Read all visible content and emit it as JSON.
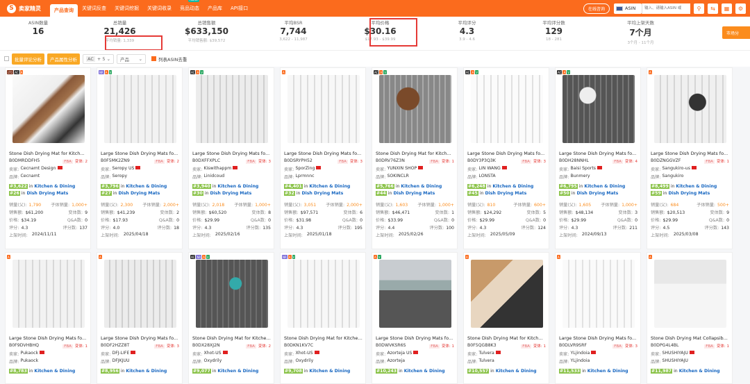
{
  "app": {
    "logo_text": "卖家精灵"
  },
  "nav": {
    "tabs": [
      "产品查询",
      "关键词反查",
      "关键词挖掘",
      "关键词收录",
      "竞品动态",
      "产品库",
      "API接口"
    ],
    "active": 0,
    "new_badge": "NEW",
    "online_consult": "在线咨询",
    "market": "ASIN",
    "search_placeholder": "输入、请输入ASIN 或"
  },
  "stats": [
    {
      "label": "ASIN数量",
      "value": "16",
      "sub": ""
    },
    {
      "label": "总销量",
      "value": "21,426",
      "sub": "平均销量: 1,339"
    },
    {
      "label": "总销售额",
      "value": "$633,150",
      "sub": "平均销售额: $39,572"
    },
    {
      "label": "平均BSR",
      "value": "7,744",
      "sub": "3,622 - 11,987"
    },
    {
      "label": "平均价格",
      "value": "$30.16",
      "sub": "$17.93 - $39.99"
    },
    {
      "label": "平均评分",
      "value": "4.3",
      "sub": "3.9 - 4.6"
    },
    {
      "label": "平均评分数",
      "value": "129",
      "sub": "18 - 281"
    },
    {
      "label": "平均上架天数",
      "value": "7个月",
      "sub": "3个月 - 11个月"
    }
  ],
  "trend_button": "市场分",
  "filters": {
    "batch_review": "批量评论分析",
    "attribute": "产品属性分析",
    "ac_label": "AC",
    "count_label": "+ 5",
    "product_select": "产品",
    "dedupe": "列表ASIN去重"
  },
  "field_labels": {
    "seller": "卖家:",
    "brand": "品牌:",
    "sales": "销量(父):",
    "child_sales": "子体销量:",
    "revenue": "销售额:",
    "variants": "变体数:",
    "price": "价格:",
    "qa": "Q&A数:",
    "rating": "评分:",
    "reviews": "评分数:",
    "listed": "上架时间:",
    "in": "in"
  },
  "products": [
    {
      "title": "Stone Dish Drying Mat for Kitch...",
      "asin": "B0DMRDDFH5",
      "fba": "FBA",
      "var": "变体: 2",
      "seller": "Cecnamt Design",
      "brand": "Cecnamt",
      "rank1": "#3,622",
      "cat1": "Kitchen & Dining",
      "rank2": "#26",
      "cat2": "Dish Drying Mats",
      "sales": "1,790",
      "child": "1,000+",
      "revenue": "$61,200",
      "variants": "9",
      "price": "$34.19",
      "qa": "0",
      "rating": "4.3",
      "reviews": "137",
      "listed": "2024/11/11",
      "badges": [
        "LTD",
        "AC",
        "A"
      ],
      "img": "a"
    },
    {
      "title": "Large Stone Dish Drying Mats fo...",
      "asin": "B0F5MK2ZN9",
      "fba": "FBA",
      "var": "变体: 2",
      "seller": "Seropy US",
      "brand": "Seropy",
      "rank1": "#3,796",
      "cat1": "Kitchen & Dining",
      "rank2": "#27",
      "cat2": "Dish Drying Mats",
      "sales": "2,300",
      "child": "2,000+",
      "revenue": "$41,239",
      "variants": "2",
      "price": "$17.93",
      "qa": "0",
      "rating": "4.0",
      "reviews": "18",
      "listed": "2025/04/18",
      "badges": [
        "NR",
        "A",
        "V"
      ],
      "img": "b"
    },
    {
      "title": "Large Stone Dish Drying Mats fo...",
      "asin": "B0DXFFXPLC",
      "fba": "FBA",
      "var": "变体: 3",
      "seller": "Kiswithappm",
      "brand": "Linidcoud",
      "rank1": "#3,940",
      "cat1": "Kitchen & Dining",
      "rank2": "#30",
      "cat2": "Dish Drying Mats",
      "sales": "2,018",
      "child": "1,000+",
      "revenue": "$60,520",
      "variants": "8",
      "price": "$29.99",
      "qa": "0",
      "rating": "4.3",
      "reviews": "135",
      "listed": "2025/02/16",
      "badges": [
        "AC",
        "A",
        "V"
      ],
      "img": "c"
    },
    {
      "title": "Large Stone Dish Drying Mats fo...",
      "asin": "B0DSRYPH52",
      "fba": "FBA",
      "var": "变体: 3",
      "seller": "SporZing",
      "brand": "Lprmnnc",
      "rank1": "#4,401",
      "cat1": "Kitchen & Dining",
      "rank2": "#32",
      "cat2": "Dish Drying Mats",
      "sales": "3,051",
      "child": "2,000+",
      "revenue": "$97,571",
      "variants": "6",
      "price": "$31.98",
      "qa": "0",
      "rating": "4.3",
      "reviews": "195",
      "listed": "2025/01/18",
      "badges": [
        "A"
      ],
      "img": "d"
    },
    {
      "title": "Stone Dish Drying Mat for Kitch...",
      "asin": "B0DRV76Z3N",
      "fba": "FBA",
      "var": "变体: 1",
      "seller": "YUNXIN SHOP",
      "brand": "SOKINCLR",
      "rank1": "#5,766",
      "cat1": "Kitchen & Dining",
      "rank2": "#44",
      "cat2": "Dish Drying Mats",
      "sales": "1,603",
      "child": "1,000+",
      "revenue": "$46,471",
      "variants": "1",
      "price": "$33.99",
      "qa": "0",
      "rating": "4.4",
      "reviews": "100",
      "listed": "2025/02/26",
      "badges": [
        "AC",
        "A",
        "V"
      ],
      "img": "e"
    },
    {
      "title": "Large Stone Dish Drying Mats fo...",
      "asin": "B0DY3P3Q3K",
      "fba": "FBA",
      "var": "变体: 3",
      "seller": "LIN WANG",
      "brand": "LONSTA",
      "rank1": "#6,248",
      "cat1": "Kitchen & Dining",
      "rank2": "#45",
      "cat2": "Dish Drying Mats",
      "sales": "810",
      "child": "600+",
      "revenue": "$24,292",
      "variants": "5",
      "price": "$29.99",
      "qa": "0",
      "rating": "4.3",
      "reviews": "124",
      "listed": "2025/05/09",
      "badges": [
        "AC",
        "A",
        "V"
      ],
      "img": "f"
    },
    {
      "title": "Large Stone Dish Drying Mats fo...",
      "asin": "B0DH28NNHL",
      "fba": "FBA",
      "var": "变体: 4",
      "seller": "Baisi Sports",
      "brand": "Bunmery",
      "rank1": "#6,795",
      "cat1": "Kitchen & Dining",
      "rank2": "#50",
      "cat2": "Dish Drying Mats",
      "sales": "1,605",
      "child": "1,000+",
      "revenue": "$48,134",
      "variants": "3",
      "price": "$29.99",
      "qa": "0",
      "rating": "4.3",
      "reviews": "211",
      "listed": "2024/09/13",
      "badges": [
        "AC",
        "A",
        "V"
      ],
      "img": "g"
    },
    {
      "title": "Large Stone Dish Drying Mats fo...",
      "asin": "B0DZNGGVZF",
      "fba": "FBA",
      "var": "变体: 1",
      "seller": "Sangukiro-us",
      "brand": "Sangukiro",
      "rank1": "#8,499",
      "cat1": "Kitchen & Dining",
      "rank2": "#59",
      "cat2": "Dish Drying Mats",
      "sales": "684",
      "child": "500+",
      "revenue": "$20,513",
      "variants": "9",
      "price": "$29.99",
      "qa": "0",
      "rating": "4.5",
      "reviews": "143",
      "listed": "2025/03/08",
      "badges": [
        "A"
      ],
      "img": "h"
    },
    {
      "title": "Large Stone Dish Drying Mats fo...",
      "asin": "B0F9DVHBHQ",
      "fba": "FBA",
      "var": "变体: 1",
      "seller": "Pukaock",
      "brand": "Pukaock",
      "rank1": "#8,783",
      "cat1": "Kitchen & Dining",
      "badges": [
        "A"
      ],
      "img": "b"
    },
    {
      "title": "Large Stone Dish Drying Mats fo...",
      "asin": "B0DF2HZZ8T",
      "fba": "FBA",
      "var": "变体: 3",
      "seller": "DFJ-LIFE",
      "brand": "DFJKJUU",
      "rank1": "#8,956",
      "cat1": "Kitchen & Dining",
      "badges": [
        "A"
      ],
      "img": "c"
    },
    {
      "title": "Stone Dish Drying Mat for Kitchen C...",
      "asin": "B0DX28XJ2N",
      "fba": "FBA",
      "var": "变体: 2",
      "seller": "Xhot-US",
      "brand": "Oxydrily",
      "rank1": "#9,077",
      "cat1": "Kitchen & Dining",
      "badges": [
        "AC",
        "NR",
        "A",
        "V"
      ],
      "img": "i"
    },
    {
      "title": "Stone Dish Drying Mat for Kitchen Co...",
      "asin": "B0DKN1KV7C",
      "fba": "",
      "var": "",
      "seller": "Xhot-US",
      "brand": "Oxydrily",
      "rank1": "#9,708",
      "cat1": "Kitchen & Dining",
      "badges": [
        "NR",
        "A",
        "V"
      ],
      "img": "d"
    },
    {
      "title": "Large Stone Dish Drying Mats fo...",
      "asin": "B0DWVKSR6S",
      "fba": "FBA",
      "var": "变体: 1",
      "seller": "Azorteja US",
      "brand": "Azorteja",
      "rank1": "#10,243",
      "cat1": "Kitchen & Dining",
      "badges": [
        "A",
        "V"
      ],
      "img": "j"
    },
    {
      "title": "Stone Dish Drying Mat for Kitch...",
      "asin": "B0F5QGB8K3",
      "fba": "FBA",
      "var": "变体: 1",
      "seller": "Tulvera",
      "brand": "Tulvera",
      "rank1": "#10,557",
      "cat1": "Kitchen & Dining",
      "badges": [
        "A"
      ],
      "img": "k"
    },
    {
      "title": "Large Stone Dish Drying Mats fo...",
      "asin": "B0DLVR9SRF",
      "fba": "FBA",
      "var": "变体: 3",
      "seller": "YLjindoia",
      "brand": "YLjindoia",
      "rank1": "#11,533",
      "cat1": "Kitchen & Dining",
      "badges": [
        "A"
      ],
      "img": "l"
    },
    {
      "title": "Stone Dish Drying Mat Collapsib...",
      "asin": "B0DPG4L4BL",
      "fba": "FBA",
      "var": "变体: 1",
      "seller": "SHUSHIYAJU",
      "brand": "SHUSHIYAJU",
      "rank1": "#11,987",
      "cat1": "Kitchen & Dining",
      "badges": [
        "A"
      ],
      "img": "m"
    }
  ],
  "colors": {
    "brand": "#fb6b1d",
    "highlight": "#e53935",
    "rank_link": "#1565c0"
  }
}
